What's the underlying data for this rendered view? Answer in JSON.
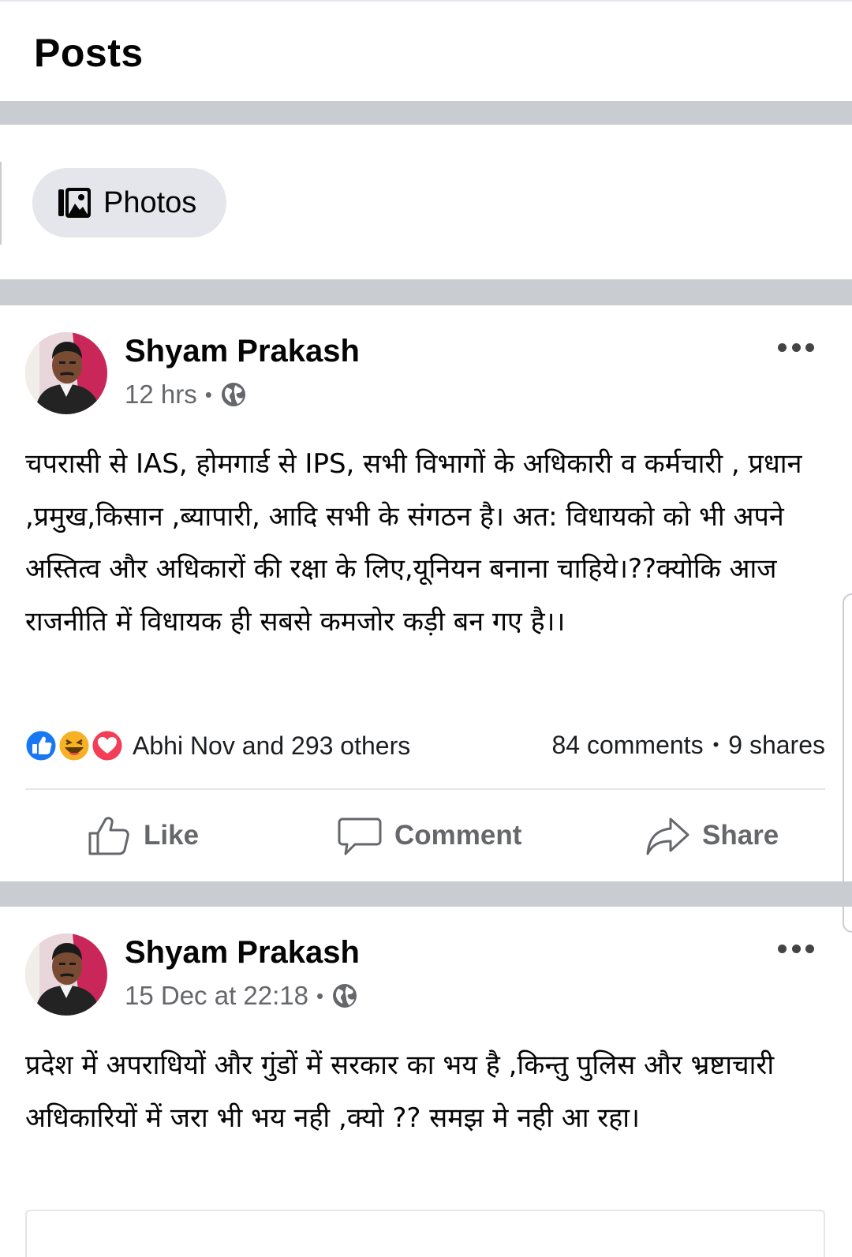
{
  "header": {
    "title": "Posts"
  },
  "filters": {
    "photos_label": "Photos",
    "photos_icon": "photos-icon"
  },
  "posts": [
    {
      "author": "Shyam Prakash",
      "time": "12 hrs",
      "privacy_icon": "globe-icon",
      "text": "चपरासी से IAS, होमगार्ड से IPS, सभी विभागों के अधिकारी व कर्मचारी , प्रधान ,प्रमुख,किसान ,ब्यापारी, आदि सभी के संगठन है। अत: विधायको को भी अपने अस्तित्व और अधिकारों की रक्षा  के लिए,यूनियन बनाना चाहिये।??क्योकि आज राजनीति में विधायक ही सबसे कमजोर कड़ी बन गए है।।",
      "reactions_text": "Abhi Nov and 293 others",
      "reaction_icons": [
        "like-icon",
        "haha-icon",
        "love-icon"
      ],
      "comments": "84 comments",
      "shares": "9 shares",
      "actions": {
        "like": "Like",
        "comment": "Comment",
        "share": "Share"
      }
    },
    {
      "author": "Shyam Prakash",
      "time": "15 Dec at 22:18",
      "privacy_icon": "globe-icon",
      "text": "प्रदेश में अपराधियों और गुंडों में सरकार का भय है ,किन्तु पुलिस और भ्रष्टाचारी अधिकारियों में जरा भी भय नही ,क्यो ?? समझ मे नही आ रहा।"
    }
  ],
  "colors": {
    "separator": "#c9ccd1",
    "chip_bg": "#e4e6eb",
    "secondary_text": "#65676b",
    "like_blue": "#1877f2",
    "love_red": "#f33e58",
    "haha_yellow": "#f7b125"
  }
}
